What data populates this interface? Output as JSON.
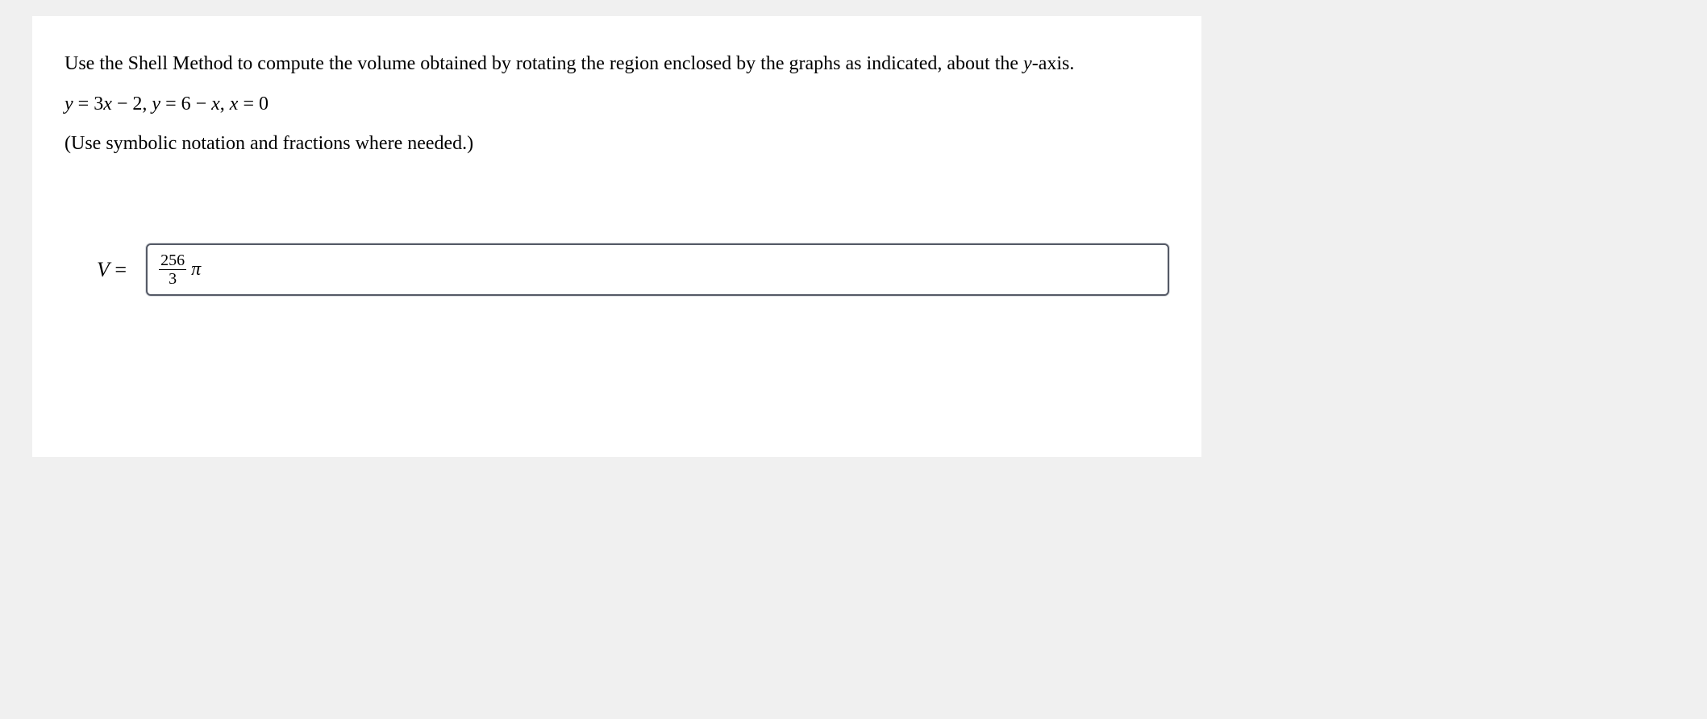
{
  "prompt": {
    "line1_before_y": "Use the Shell Method to compute the volume obtained by rotating the region enclosed by the graphs as indicated, about the ",
    "y": "y",
    "line1_after_y": "-axis."
  },
  "equations": {
    "text": "y = 3x − 2, y = 6 − x, x = 0"
  },
  "hint": "(Use symbolic notation and fractions where needed.)",
  "answer": {
    "label_V": "V",
    "label_eq": " = ",
    "numerator": "256",
    "denominator": "3",
    "pi": "π"
  }
}
